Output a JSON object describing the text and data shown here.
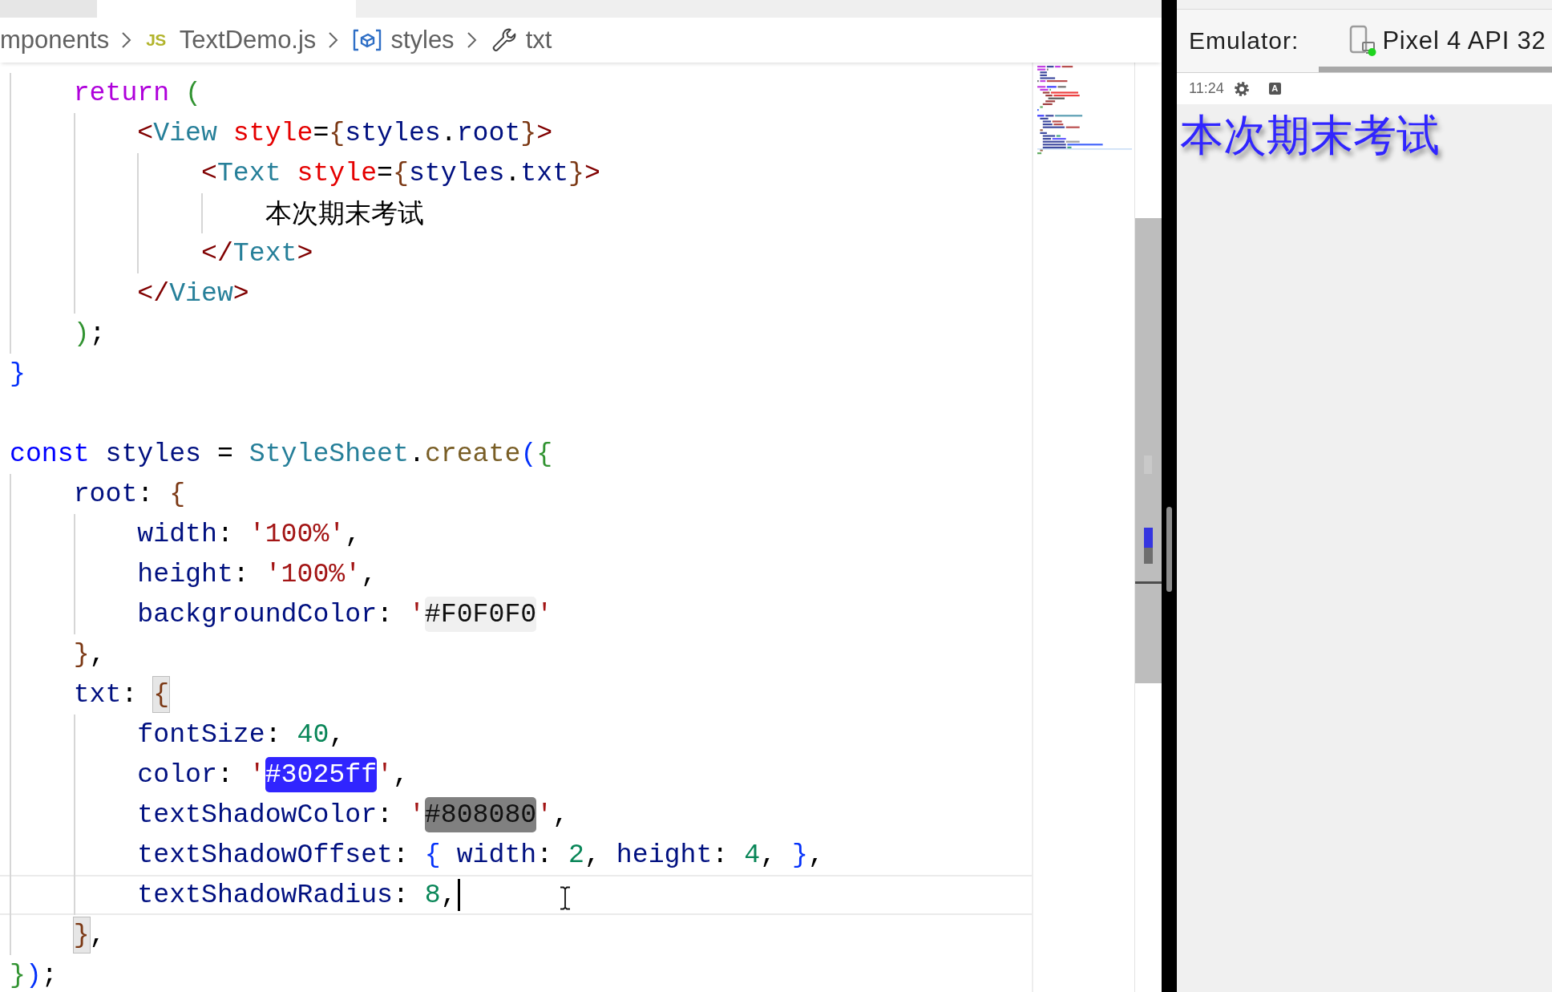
{
  "editor": {
    "tabs": [
      {
        "selected": false
      },
      {
        "selected": true
      }
    ],
    "breadcrumbs": [
      {
        "kind": "folder",
        "label": "mponents"
      },
      {
        "kind": "file",
        "badge": "JS",
        "label": "TextDemo.js"
      },
      {
        "kind": "variable",
        "label": "styles"
      },
      {
        "kind": "property",
        "label": "txt"
      }
    ],
    "lines": [
      {
        "children": [
          {
            "current": false,
            "tokens": [
              {
                "kind": "control",
                "text": "return"
              },
              {
                "kind": "bracket2",
                "text": " ("
              }
            ],
            "children": [
              {
                "current": false,
                "tokens": [
                  {
                    "kind": "tag",
                    "text": "<"
                  },
                  {
                    "kind": "component",
                    "text": "View"
                  },
                  {
                    "kind": "attribute",
                    "text": " style"
                  },
                  {
                    "kind": "operator",
                    "text": "="
                  },
                  {
                    "kind": "bracket3",
                    "text": "{"
                  },
                  {
                    "kind": "variable",
                    "text": "styles"
                  },
                  {
                    "kind": "operator",
                    "text": "."
                  },
                  {
                    "kind": "variable",
                    "text": "root"
                  },
                  {
                    "kind": "bracket3",
                    "text": "}"
                  },
                  {
                    "kind": "tag",
                    "text": ">"
                  }
                ],
                "children": [
                  {
                    "current": false,
                    "tokens": [
                      {
                        "kind": "tag",
                        "text": "<"
                      },
                      {
                        "kind": "component",
                        "text": "Text"
                      },
                      {
                        "kind": "attribute",
                        "text": " style"
                      },
                      {
                        "kind": "operator",
                        "text": "="
                      },
                      {
                        "kind": "bracket3",
                        "text": "{"
                      },
                      {
                        "kind": "variable",
                        "text": "styles"
                      },
                      {
                        "kind": "operator",
                        "text": "."
                      },
                      {
                        "kind": "variable",
                        "text": "txt"
                      },
                      {
                        "kind": "bracket3",
                        "text": "}"
                      },
                      {
                        "kind": "tag",
                        "text": ">"
                      }
                    ],
                    "children": [
                      {
                        "current": false,
                        "tokens": [
                          {
                            "kind": "plain",
                            "text": "本次期末考试"
                          }
                        ]
                      }
                    ]
                  },
                  {
                    "current": false,
                    "tokens": [
                      {
                        "kind": "tag",
                        "text": "</"
                      },
                      {
                        "kind": "component",
                        "text": "Text"
                      },
                      {
                        "kind": "tag",
                        "text": ">"
                      }
                    ]
                  }
                ]
              },
              {
                "current": false,
                "tokens": [
                  {
                    "kind": "tag",
                    "text": "</"
                  },
                  {
                    "kind": "component",
                    "text": "View"
                  },
                  {
                    "kind": "tag",
                    "text": ">"
                  }
                ]
              }
            ]
          },
          {
            "current": false,
            "tokens": [
              {
                "kind": "bracket2",
                "text": ")"
              },
              {
                "kind": "operator",
                "text": ";"
              }
            ]
          }
        ]
      },
      {
        "current": false,
        "tokens": [
          {
            "kind": "bracket1",
            "text": "}"
          }
        ]
      },
      {
        "current": false
      },
      {
        "current": false,
        "tokens": [
          {
            "kind": "keyword",
            "text": "const"
          },
          {
            "kind": "variable",
            "text": " styles"
          },
          {
            "kind": "operator",
            "text": " ="
          },
          {
            "kind": "class",
            "text": " StyleSheet"
          },
          {
            "kind": "operator",
            "text": "."
          },
          {
            "kind": "function",
            "text": "create"
          },
          {
            "kind": "bracket1",
            "text": "("
          },
          {
            "kind": "bracket2",
            "text": "{"
          }
        ],
        "children": [
          {
            "current": false,
            "tokens": [
              {
                "kind": "variable",
                "text": "root"
              },
              {
                "kind": "operator",
                "text": ":"
              },
              {
                "kind": "bracket3",
                "text": " {"
              }
            ],
            "children": [
              {
                "current": false,
                "tokens": [
                  {
                    "kind": "variable",
                    "text": "width"
                  },
                  {
                    "kind": "operator",
                    "text": ":"
                  },
                  {
                    "kind": "string",
                    "text": " '100%'"
                  },
                  {
                    "kind": "operator",
                    "text": ","
                  }
                ]
              },
              {
                "current": false,
                "tokens": [
                  {
                    "kind": "variable",
                    "text": "height"
                  },
                  {
                    "kind": "operator",
                    "text": ":"
                  },
                  {
                    "kind": "string",
                    "text": " '100%'"
                  },
                  {
                    "kind": "operator",
                    "text": ","
                  }
                ]
              },
              {
                "current": false,
                "tokens": [
                  {
                    "kind": "variable",
                    "text": "backgroundColor"
                  },
                  {
                    "kind": "operator",
                    "text": ":"
                  },
                  {
                    "kind": "string",
                    "text": " '"
                  },
                  {
                    "kind": "swatch",
                    "text": "#F0F0F0",
                    "color": "#f0f0f0"
                  },
                  {
                    "kind": "string",
                    "text": "'"
                  }
                ]
              }
            ]
          },
          {
            "current": false,
            "tokens": [
              {
                "kind": "bracket3",
                "text": "}"
              },
              {
                "kind": "operator",
                "text": ","
              }
            ]
          },
          {
            "current": false,
            "tokens": [
              {
                "kind": "variable",
                "text": "txt"
              },
              {
                "kind": "operator",
                "text": ":"
              },
              {
                "kind": "match",
                "text": " {"
              }
            ],
            "children": [
              {
                "current": false,
                "tokens": [
                  {
                    "kind": "variable",
                    "text": "fontSize"
                  },
                  {
                    "kind": "operator",
                    "text": ":"
                  },
                  {
                    "kind": "number",
                    "text": " 40"
                  },
                  {
                    "kind": "operator",
                    "text": ","
                  }
                ]
              },
              {
                "current": false,
                "tokens": [
                  {
                    "kind": "variable",
                    "text": "color"
                  },
                  {
                    "kind": "operator",
                    "text": ":"
                  },
                  {
                    "kind": "string",
                    "text": " '"
                  },
                  {
                    "kind": "swatch",
                    "text": "#3025ff",
                    "color": "#3025ff"
                  },
                  {
                    "kind": "string",
                    "text": "'"
                  },
                  {
                    "kind": "operator",
                    "text": ","
                  }
                ]
              },
              {
                "current": false,
                "tokens": [
                  {
                    "kind": "variable",
                    "text": "textShadowColor"
                  },
                  {
                    "kind": "operator",
                    "text": ":"
                  },
                  {
                    "kind": "string",
                    "text": " '"
                  },
                  {
                    "kind": "swatch",
                    "text": "#808080",
                    "color": "#808080"
                  },
                  {
                    "kind": "string",
                    "text": "'"
                  },
                  {
                    "kind": "operator",
                    "text": ","
                  }
                ]
              },
              {
                "current": false,
                "tokens": [
                  {
                    "kind": "variable",
                    "text": "textShadowOffset"
                  },
                  {
                    "kind": "operator",
                    "text": ":"
                  },
                  {
                    "kind": "bracket1",
                    "text": " {"
                  },
                  {
                    "kind": "variable",
                    "text": " width"
                  },
                  {
                    "kind": "operator",
                    "text": ":"
                  },
                  {
                    "kind": "number",
                    "text": " 2"
                  },
                  {
                    "kind": "operator",
                    "text": ","
                  },
                  {
                    "kind": "variable",
                    "text": " height"
                  },
                  {
                    "kind": "operator",
                    "text": ":"
                  },
                  {
                    "kind": "number",
                    "text": " 4"
                  },
                  {
                    "kind": "operator",
                    "text": ","
                  },
                  {
                    "kind": "bracket1",
                    "text": " }"
                  },
                  {
                    "kind": "operator",
                    "text": ","
                  }
                ]
              },
              {
                "current": true,
                "tokens": [
                  {
                    "kind": "variable",
                    "text": "textShadowRadius"
                  },
                  {
                    "kind": "operator",
                    "text": ":"
                  },
                  {
                    "kind": "number",
                    "text": " 8"
                  },
                  {
                    "kind": "operator",
                    "text": ","
                  }
                ]
              }
            ]
          },
          {
            "current": false,
            "tokens": [
              {
                "kind": "match",
                "text": "}"
              },
              {
                "kind": "operator",
                "text": ","
              }
            ]
          }
        ]
      },
      {
        "current": false,
        "tokens": [
          {
            "kind": "bracket2",
            "text": "}"
          },
          {
            "kind": "bracket1",
            "text": ")"
          },
          {
            "kind": "operator",
            "text": ";"
          }
        ]
      }
    ]
  },
  "emulator": {
    "title": "Emulator:",
    "devices": [
      {
        "label": "Pixel 4 API 32",
        "selected": true
      }
    ],
    "status_bar": {
      "time": "11:24",
      "notification": "A"
    },
    "screen_text": "本次期末考试"
  }
}
